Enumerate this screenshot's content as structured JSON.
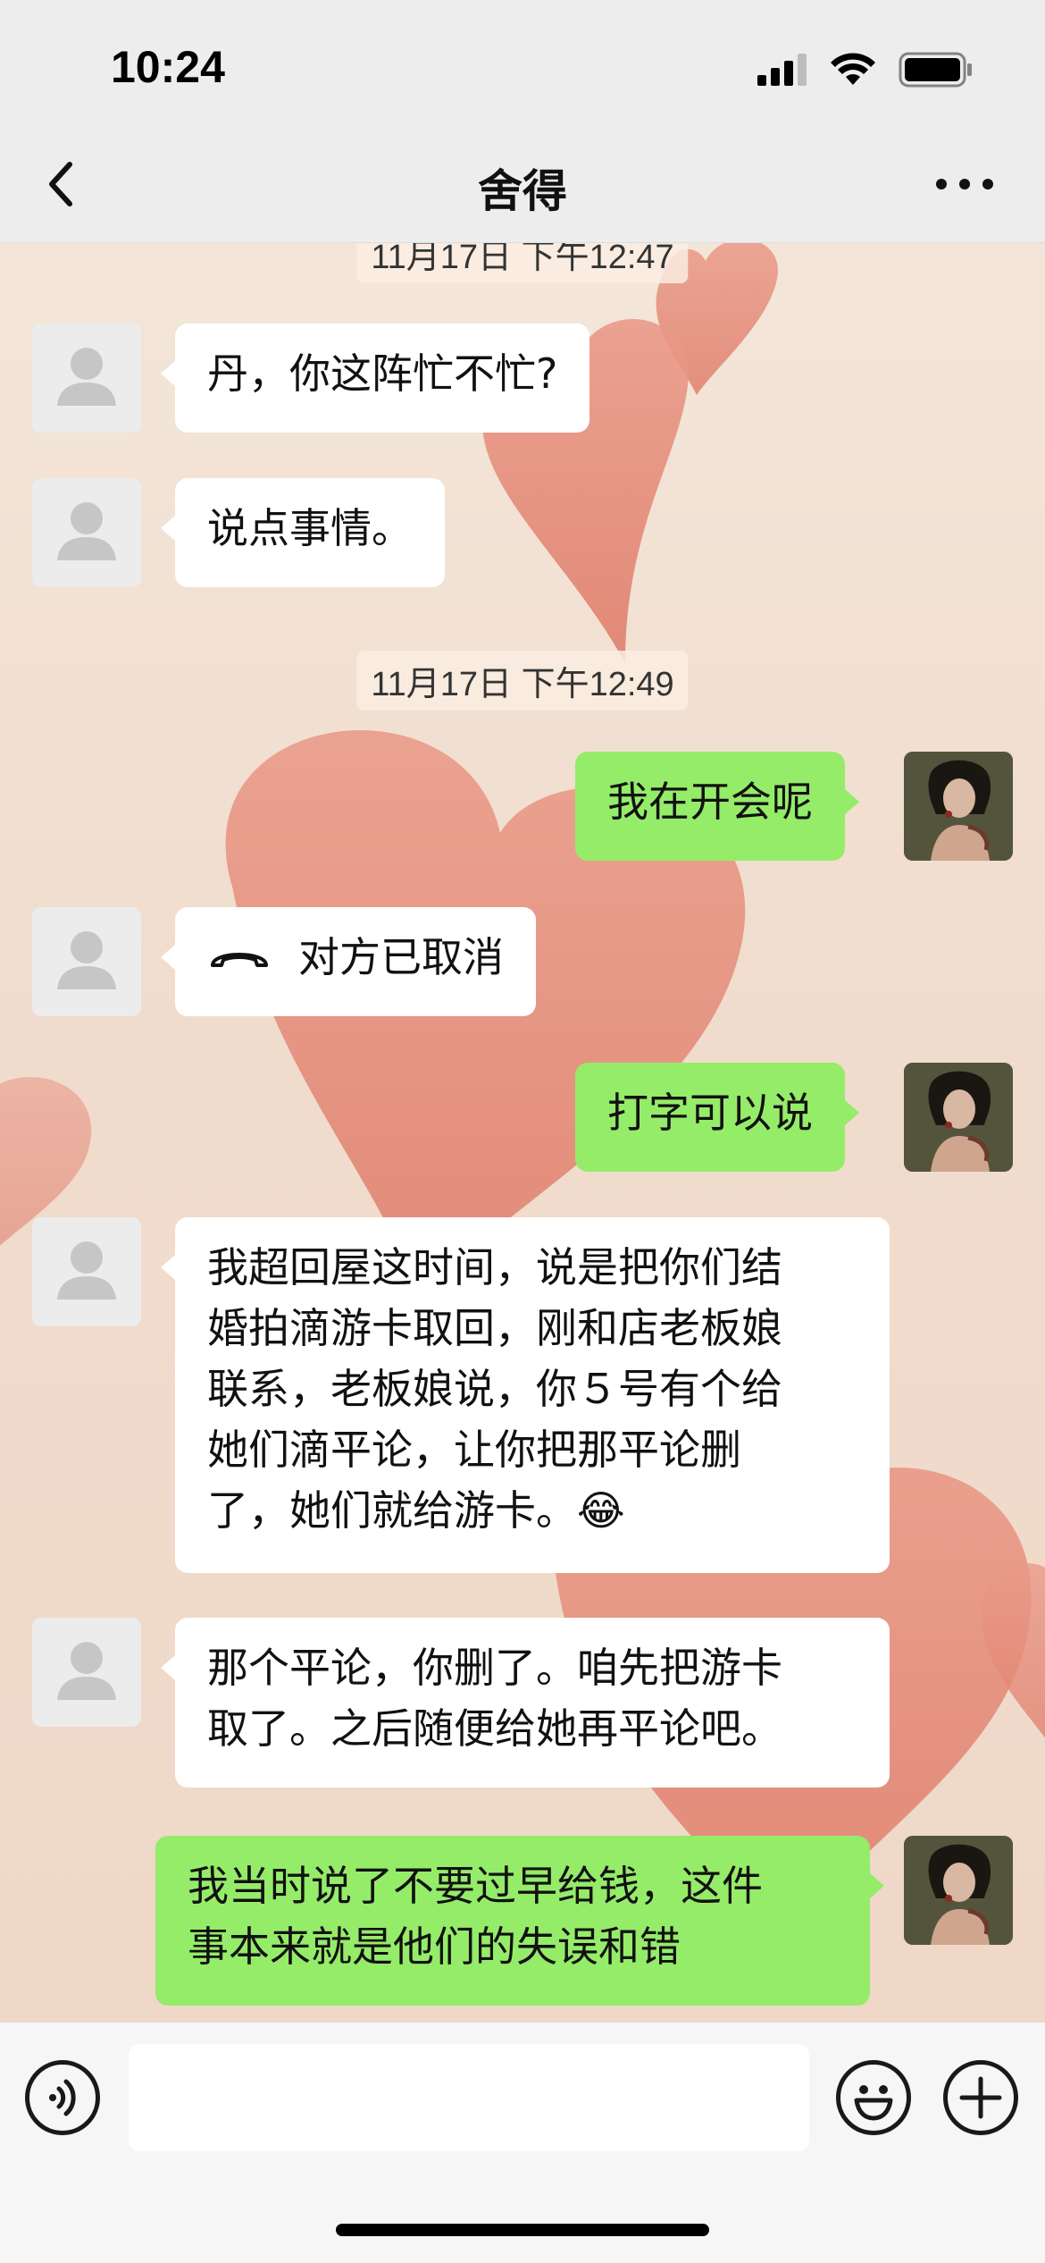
{
  "status_bar": {
    "time": "10:24"
  },
  "nav": {
    "title": "舍得"
  },
  "messages": {
    "ts1": "11月17日 下午12:47",
    "m1": "丹，你这阵忙不忙?",
    "m2": "说点事情。",
    "ts2": "11月17日 下午12:49",
    "m3": "我在开会呢",
    "m4": "对方已取消",
    "m5": "打字可以说",
    "m6_l1": "我超回屋这时间，说是把你们结",
    "m6_l2": "婚拍滴游卡取回，刚和店老板娘",
    "m6_l3": "联系，老板娘说，你５号有个给",
    "m6_l4": "她们滴平论，让你把那平论删",
    "m6_l5": "了，她们就给游卡。",
    "m6_emoji": "😂",
    "m7_l1": "那个平论，你删了。咱先把游卡",
    "m7_l2": "取了。之后随便给她再平论吧。",
    "m8_l1": "我当时说了不要过早给钱，这件",
    "m8_l2": "事本来就是他们的失误和错"
  },
  "colors": {
    "sent_bubble": "#95ec69",
    "received_bubble": "#ffffff",
    "chat_background": "#f0dccd",
    "heart": "#e58d7c"
  },
  "icons": [
    "back-chevron-icon",
    "more-dots-icon",
    "signal-icon",
    "wifi-icon",
    "battery-icon",
    "phone-hangup-icon",
    "voice-icon",
    "emoji-icon",
    "plus-icon"
  ]
}
